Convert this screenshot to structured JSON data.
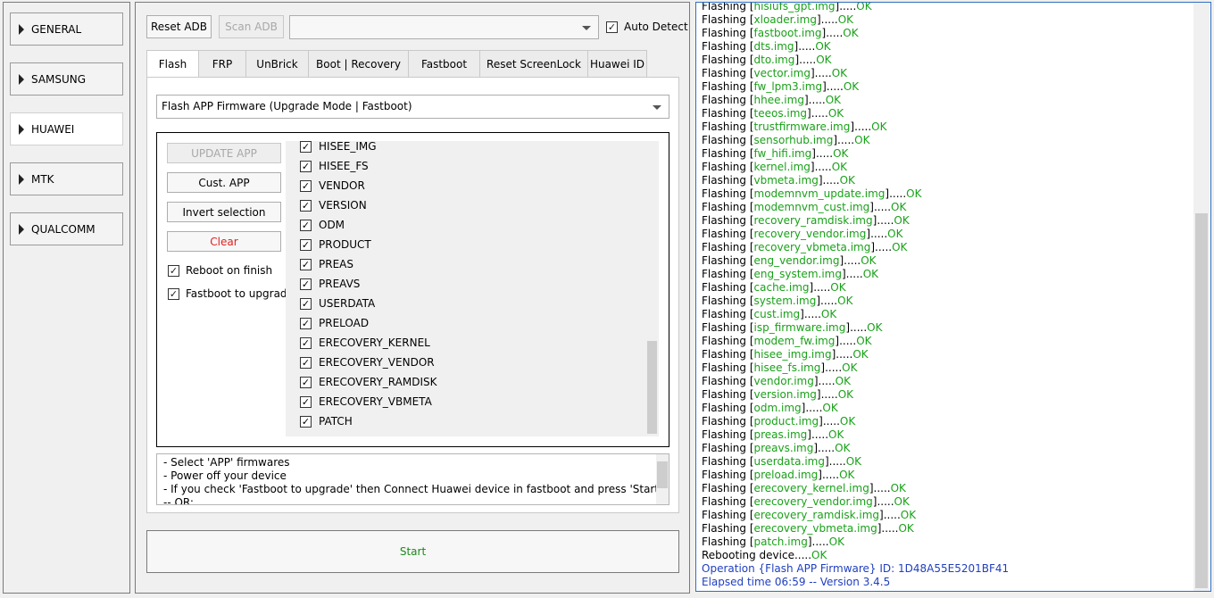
{
  "nav": {
    "items": [
      {
        "label": "GENERAL"
      },
      {
        "label": "SAMSUNG"
      },
      {
        "label": "HUAWEI"
      },
      {
        "label": "MTK"
      },
      {
        "label": "QUALCOMM"
      }
    ],
    "active": "HUAWEI"
  },
  "toolbar": {
    "reset_adb": "Reset ADB",
    "scan_adb": "Scan ADB",
    "device_select_value": "",
    "auto_detect": "Auto Detect",
    "auto_detect_checked": true
  },
  "tabs": [
    {
      "label": "Flash"
    },
    {
      "label": "FRP"
    },
    {
      "label": "UnBrick"
    },
    {
      "label": "Boot | Recovery"
    },
    {
      "label": "Fastboot"
    },
    {
      "label": "Reset ScreenLock"
    },
    {
      "label": "Huawei ID"
    }
  ],
  "flash": {
    "mode_select": "Flash APP Firmware (Upgrade Mode | Fastboot)",
    "update_app": "UPDATE APP",
    "cust_app": "Cust. APP",
    "invert_selection": "Invert selection",
    "clear": "Clear",
    "reboot_on_finish": "Reboot on finish",
    "fastboot_to_upgrade": "Fastboot to upgrade",
    "partitions": [
      "HISEE_IMG",
      "HISEE_FS",
      "VENDOR",
      "VERSION",
      "ODM",
      "PRODUCT",
      "PREAS",
      "PREAVS",
      "USERDATA",
      "PRELOAD",
      "ERECOVERY_KERNEL",
      "ERECOVERY_VENDOR",
      "ERECOVERY_RAMDISK",
      "ERECOVERY_VBMETA",
      "PATCH"
    ],
    "instructions": [
      "- Select 'APP' firmwares",
      "- Power off your device",
      "- If you check 'Fastboot to upgrade' then Connect Huawei device in fastboot and press 'Start'",
      "-- OR:"
    ],
    "start": "Start"
  },
  "log": {
    "prefix": "Flashing ",
    "ok": "OK",
    "dots": ".....",
    "files": [
      "hisiufs_gpt.img",
      "xloader.img",
      "fastboot.img",
      "dts.img",
      "dto.img",
      "vector.img",
      "fw_lpm3.img",
      "hhee.img",
      "teeos.img",
      "trustfirmware.img",
      "sensorhub.img",
      "fw_hifi.img",
      "kernel.img",
      "vbmeta.img",
      "modemnvm_update.img",
      "modemnvm_cust.img",
      "recovery_ramdisk.img",
      "recovery_vendor.img",
      "recovery_vbmeta.img",
      "eng_vendor.img",
      "eng_system.img",
      "cache.img",
      "system.img",
      "cust.img",
      "isp_firmware.img",
      "modem_fw.img",
      "hisee_img.img",
      "hisee_fs.img",
      "vendor.img",
      "version.img",
      "odm.img",
      "product.img",
      "preas.img",
      "preavs.img",
      "userdata.img",
      "preload.img",
      "erecovery_kernel.img",
      "erecovery_vendor.img",
      "erecovery_ramdisk.img",
      "erecovery_vbmeta.img",
      "patch.img"
    ],
    "rebooting": "Rebooting device.....",
    "operation": "Operation {Flash APP Firmware} ID: 1D48A55E5201BF41",
    "elapsed": "Elapsed time 06:59 -- Version 3.4.5"
  }
}
